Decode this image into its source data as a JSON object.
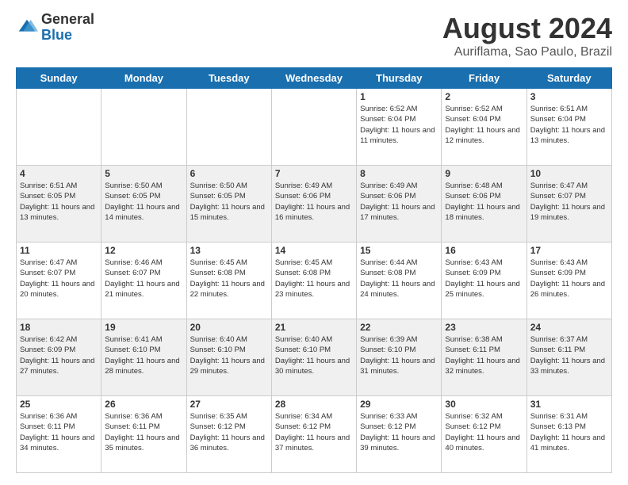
{
  "header": {
    "logo_general": "General",
    "logo_blue": "Blue",
    "month_title": "August 2024",
    "location": "Auriflama, Sao Paulo, Brazil"
  },
  "weekdays": [
    "Sunday",
    "Monday",
    "Tuesday",
    "Wednesday",
    "Thursday",
    "Friday",
    "Saturday"
  ],
  "weeks": [
    [
      {
        "day": "",
        "info": ""
      },
      {
        "day": "",
        "info": ""
      },
      {
        "day": "",
        "info": ""
      },
      {
        "day": "",
        "info": ""
      },
      {
        "day": "1",
        "info": "Sunrise: 6:52 AM\nSunset: 6:04 PM\nDaylight: 11 hours and 11 minutes."
      },
      {
        "day": "2",
        "info": "Sunrise: 6:52 AM\nSunset: 6:04 PM\nDaylight: 11 hours and 12 minutes."
      },
      {
        "day": "3",
        "info": "Sunrise: 6:51 AM\nSunset: 6:04 PM\nDaylight: 11 hours and 13 minutes."
      }
    ],
    [
      {
        "day": "4",
        "info": "Sunrise: 6:51 AM\nSunset: 6:05 PM\nDaylight: 11 hours and 13 minutes."
      },
      {
        "day": "5",
        "info": "Sunrise: 6:50 AM\nSunset: 6:05 PM\nDaylight: 11 hours and 14 minutes."
      },
      {
        "day": "6",
        "info": "Sunrise: 6:50 AM\nSunset: 6:05 PM\nDaylight: 11 hours and 15 minutes."
      },
      {
        "day": "7",
        "info": "Sunrise: 6:49 AM\nSunset: 6:06 PM\nDaylight: 11 hours and 16 minutes."
      },
      {
        "day": "8",
        "info": "Sunrise: 6:49 AM\nSunset: 6:06 PM\nDaylight: 11 hours and 17 minutes."
      },
      {
        "day": "9",
        "info": "Sunrise: 6:48 AM\nSunset: 6:06 PM\nDaylight: 11 hours and 18 minutes."
      },
      {
        "day": "10",
        "info": "Sunrise: 6:47 AM\nSunset: 6:07 PM\nDaylight: 11 hours and 19 minutes."
      }
    ],
    [
      {
        "day": "11",
        "info": "Sunrise: 6:47 AM\nSunset: 6:07 PM\nDaylight: 11 hours and 20 minutes."
      },
      {
        "day": "12",
        "info": "Sunrise: 6:46 AM\nSunset: 6:07 PM\nDaylight: 11 hours and 21 minutes."
      },
      {
        "day": "13",
        "info": "Sunrise: 6:45 AM\nSunset: 6:08 PM\nDaylight: 11 hours and 22 minutes."
      },
      {
        "day": "14",
        "info": "Sunrise: 6:45 AM\nSunset: 6:08 PM\nDaylight: 11 hours and 23 minutes."
      },
      {
        "day": "15",
        "info": "Sunrise: 6:44 AM\nSunset: 6:08 PM\nDaylight: 11 hours and 24 minutes."
      },
      {
        "day": "16",
        "info": "Sunrise: 6:43 AM\nSunset: 6:09 PM\nDaylight: 11 hours and 25 minutes."
      },
      {
        "day": "17",
        "info": "Sunrise: 6:43 AM\nSunset: 6:09 PM\nDaylight: 11 hours and 26 minutes."
      }
    ],
    [
      {
        "day": "18",
        "info": "Sunrise: 6:42 AM\nSunset: 6:09 PM\nDaylight: 11 hours and 27 minutes."
      },
      {
        "day": "19",
        "info": "Sunrise: 6:41 AM\nSunset: 6:10 PM\nDaylight: 11 hours and 28 minutes."
      },
      {
        "day": "20",
        "info": "Sunrise: 6:40 AM\nSunset: 6:10 PM\nDaylight: 11 hours and 29 minutes."
      },
      {
        "day": "21",
        "info": "Sunrise: 6:40 AM\nSunset: 6:10 PM\nDaylight: 11 hours and 30 minutes."
      },
      {
        "day": "22",
        "info": "Sunrise: 6:39 AM\nSunset: 6:10 PM\nDaylight: 11 hours and 31 minutes."
      },
      {
        "day": "23",
        "info": "Sunrise: 6:38 AM\nSunset: 6:11 PM\nDaylight: 11 hours and 32 minutes."
      },
      {
        "day": "24",
        "info": "Sunrise: 6:37 AM\nSunset: 6:11 PM\nDaylight: 11 hours and 33 minutes."
      }
    ],
    [
      {
        "day": "25",
        "info": "Sunrise: 6:36 AM\nSunset: 6:11 PM\nDaylight: 11 hours and 34 minutes."
      },
      {
        "day": "26",
        "info": "Sunrise: 6:36 AM\nSunset: 6:11 PM\nDaylight: 11 hours and 35 minutes."
      },
      {
        "day": "27",
        "info": "Sunrise: 6:35 AM\nSunset: 6:12 PM\nDaylight: 11 hours and 36 minutes."
      },
      {
        "day": "28",
        "info": "Sunrise: 6:34 AM\nSunset: 6:12 PM\nDaylight: 11 hours and 37 minutes."
      },
      {
        "day": "29",
        "info": "Sunrise: 6:33 AM\nSunset: 6:12 PM\nDaylight: 11 hours and 39 minutes."
      },
      {
        "day": "30",
        "info": "Sunrise: 6:32 AM\nSunset: 6:12 PM\nDaylight: 11 hours and 40 minutes."
      },
      {
        "day": "31",
        "info": "Sunrise: 6:31 AM\nSunset: 6:13 PM\nDaylight: 11 hours and 41 minutes."
      }
    ]
  ]
}
